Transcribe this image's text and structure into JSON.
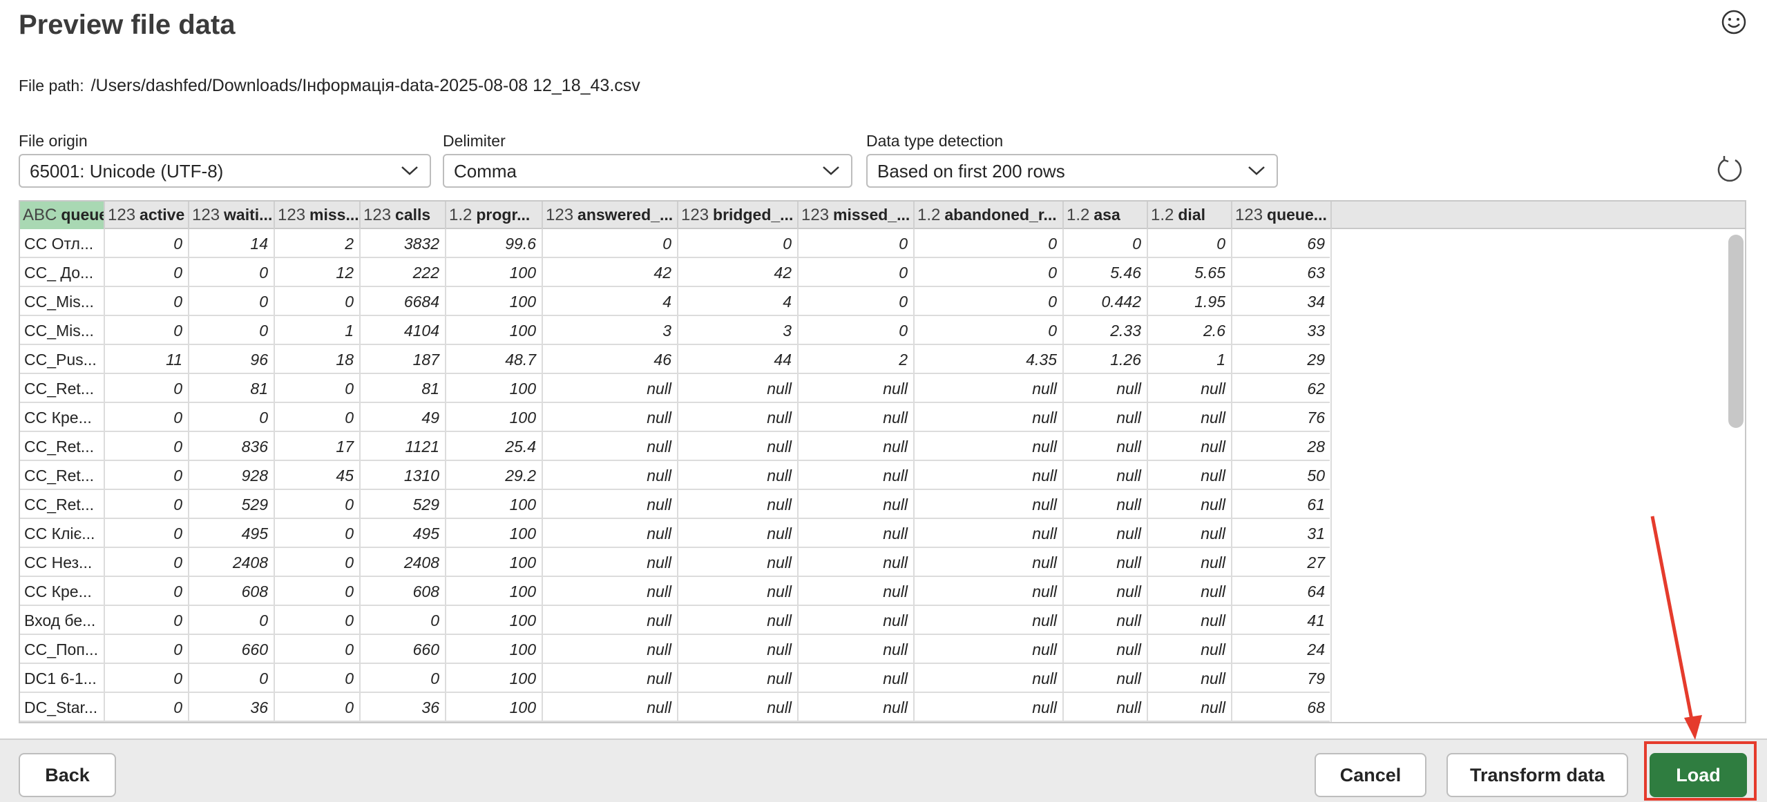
{
  "title": "Preview file data",
  "file_path": {
    "label": "File path:",
    "value": "/Users/dashfed/Downloads/Інформація-data-2025-08-08 12_18_43.csv"
  },
  "fields": {
    "file_origin": {
      "label": "File origin",
      "value": "65001: Unicode (UTF-8)"
    },
    "delimiter": {
      "label": "Delimiter",
      "value": "Comma"
    },
    "data_type_detection": {
      "label": "Data type detection",
      "value": "Based on first 200 rows"
    }
  },
  "columns": [
    {
      "type": "ABC",
      "name": "queue"
    },
    {
      "type": "123",
      "name": "active"
    },
    {
      "type": "123",
      "name": "waiti..."
    },
    {
      "type": "123",
      "name": "miss..."
    },
    {
      "type": "123",
      "name": "calls"
    },
    {
      "type": "1.2",
      "name": "progr..."
    },
    {
      "type": "123",
      "name": "answered_..."
    },
    {
      "type": "123",
      "name": "bridged_..."
    },
    {
      "type": "123",
      "name": "missed_..."
    },
    {
      "type": "1.2",
      "name": "abandoned_r..."
    },
    {
      "type": "1.2",
      "name": "asa"
    },
    {
      "type": "1.2",
      "name": "dial"
    },
    {
      "type": "123",
      "name": "queue..."
    }
  ],
  "rows": [
    [
      "CC Отл...",
      "0",
      "14",
      "2",
      "3832",
      "99.6",
      "0",
      "0",
      "0",
      "0",
      "0",
      "0",
      "69"
    ],
    [
      "CC_ До...",
      "0",
      "0",
      "12",
      "222",
      "100",
      "42",
      "42",
      "0",
      "0",
      "5.46",
      "5.65",
      "63"
    ],
    [
      "CC_Mis...",
      "0",
      "0",
      "0",
      "6684",
      "100",
      "4",
      "4",
      "0",
      "0",
      "0.442",
      "1.95",
      "34"
    ],
    [
      "CC_Mis...",
      "0",
      "0",
      "1",
      "4104",
      "100",
      "3",
      "3",
      "0",
      "0",
      "2.33",
      "2.6",
      "33"
    ],
    [
      "CC_Pus...",
      "11",
      "96",
      "18",
      "187",
      "48.7",
      "46",
      "44",
      "2",
      "4.35",
      "1.26",
      "1",
      "29"
    ],
    [
      "CC_Ret...",
      "0",
      "81",
      "0",
      "81",
      "100",
      "null",
      "null",
      "null",
      "null",
      "null",
      "null",
      "62"
    ],
    [
      "CC Кре...",
      "0",
      "0",
      "0",
      "49",
      "100",
      "null",
      "null",
      "null",
      "null",
      "null",
      "null",
      "76"
    ],
    [
      "CC_Ret...",
      "0",
      "836",
      "17",
      "1121",
      "25.4",
      "null",
      "null",
      "null",
      "null",
      "null",
      "null",
      "28"
    ],
    [
      "CC_Ret...",
      "0",
      "928",
      "45",
      "1310",
      "29.2",
      "null",
      "null",
      "null",
      "null",
      "null",
      "null",
      "50"
    ],
    [
      "CC_Ret...",
      "0",
      "529",
      "0",
      "529",
      "100",
      "null",
      "null",
      "null",
      "null",
      "null",
      "null",
      "61"
    ],
    [
      "CC Кліє...",
      "0",
      "495",
      "0",
      "495",
      "100",
      "null",
      "null",
      "null",
      "null",
      "null",
      "null",
      "31"
    ],
    [
      "CC Нез...",
      "0",
      "2408",
      "0",
      "2408",
      "100",
      "null",
      "null",
      "null",
      "null",
      "null",
      "null",
      "27"
    ],
    [
      "CC Кре...",
      "0",
      "608",
      "0",
      "608",
      "100",
      "null",
      "null",
      "null",
      "null",
      "null",
      "null",
      "64"
    ],
    [
      "Вход бе...",
      "0",
      "0",
      "0",
      "0",
      "100",
      "null",
      "null",
      "null",
      "null",
      "null",
      "null",
      "41"
    ],
    [
      "CC_Поп...",
      "0",
      "660",
      "0",
      "660",
      "100",
      "null",
      "null",
      "null",
      "null",
      "null",
      "null",
      "24"
    ],
    [
      "DC1 6-1...",
      "0",
      "0",
      "0",
      "0",
      "100",
      "null",
      "null",
      "null",
      "null",
      "null",
      "null",
      "79"
    ],
    [
      "DC_Star...",
      "0",
      "36",
      "0",
      "36",
      "100",
      "null",
      "null",
      "null",
      "null",
      "null",
      "null",
      "68"
    ]
  ],
  "footer": {
    "back_label": "Back",
    "cancel_label": "Cancel",
    "transform_label": "Transform data",
    "load_label": "Load"
  },
  "colors": {
    "accent": "#2f7d40",
    "highlight": "#e53b2c",
    "selected_column": "#a9d8b3"
  },
  "icons": [
    "smiley-icon",
    "chevron-down-icon",
    "refresh-icon"
  ]
}
